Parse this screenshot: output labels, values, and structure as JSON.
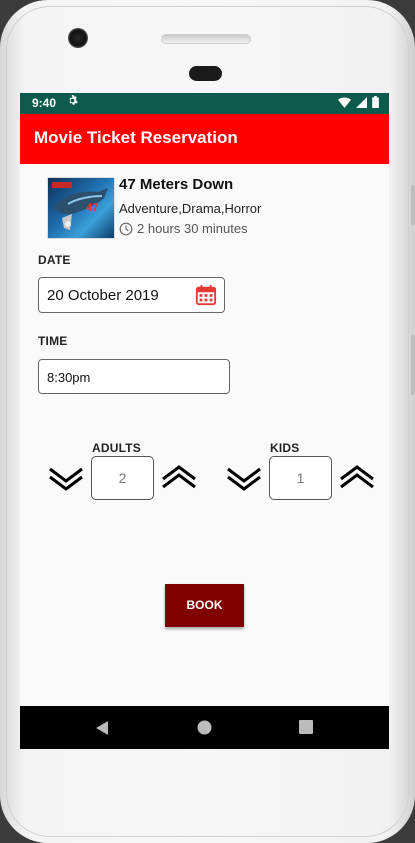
{
  "status_bar": {
    "time": "9:40"
  },
  "app_bar": {
    "title": "Movie Ticket Reservation"
  },
  "movie": {
    "title": "47 Meters Down",
    "genres": "Adventure,Drama,Horror",
    "duration": "2 hours 30 minutes",
    "poster_text": "47"
  },
  "date": {
    "label": "DATE",
    "value": "20 October 2019"
  },
  "time": {
    "label": "TIME",
    "value": "8:30pm"
  },
  "adults": {
    "label": "ADULTS",
    "count": "2"
  },
  "kids": {
    "label": "KIDS",
    "count": "1"
  },
  "book_label": "BOOK",
  "colors": {
    "app_bar": "#ff0000",
    "status_bar": "#0b5a4c",
    "book_button": "#800000",
    "calendar": "#e53935"
  },
  "icons": [
    "gear-icon",
    "wifi-icon",
    "signal-icon",
    "battery-icon",
    "clock-icon",
    "calendar-icon",
    "chevron-down-icon",
    "chevron-up-icon",
    "back-icon",
    "home-icon",
    "recents-icon"
  ]
}
